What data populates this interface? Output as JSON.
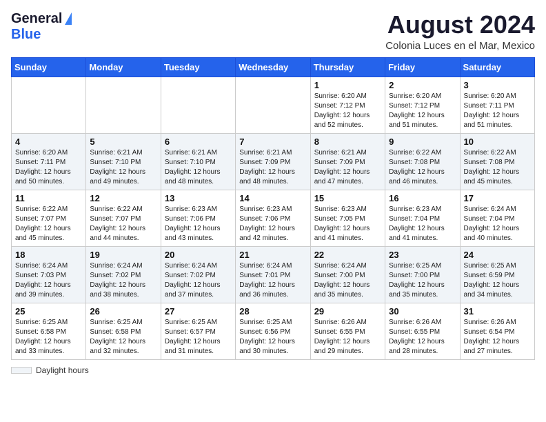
{
  "header": {
    "logo_general": "General",
    "logo_blue": "Blue",
    "month_title": "August 2024",
    "location": "Colonia Luces en el Mar, Mexico"
  },
  "days_of_week": [
    "Sunday",
    "Monday",
    "Tuesday",
    "Wednesday",
    "Thursday",
    "Friday",
    "Saturday"
  ],
  "weeks": [
    [
      {
        "day": "",
        "info": ""
      },
      {
        "day": "",
        "info": ""
      },
      {
        "day": "",
        "info": ""
      },
      {
        "day": "",
        "info": ""
      },
      {
        "day": "1",
        "info": "Sunrise: 6:20 AM\nSunset: 7:12 PM\nDaylight: 12 hours\nand 52 minutes."
      },
      {
        "day": "2",
        "info": "Sunrise: 6:20 AM\nSunset: 7:12 PM\nDaylight: 12 hours\nand 51 minutes."
      },
      {
        "day": "3",
        "info": "Sunrise: 6:20 AM\nSunset: 7:11 PM\nDaylight: 12 hours\nand 51 minutes."
      }
    ],
    [
      {
        "day": "4",
        "info": "Sunrise: 6:20 AM\nSunset: 7:11 PM\nDaylight: 12 hours\nand 50 minutes."
      },
      {
        "day": "5",
        "info": "Sunrise: 6:21 AM\nSunset: 7:10 PM\nDaylight: 12 hours\nand 49 minutes."
      },
      {
        "day": "6",
        "info": "Sunrise: 6:21 AM\nSunset: 7:10 PM\nDaylight: 12 hours\nand 48 minutes."
      },
      {
        "day": "7",
        "info": "Sunrise: 6:21 AM\nSunset: 7:09 PM\nDaylight: 12 hours\nand 48 minutes."
      },
      {
        "day": "8",
        "info": "Sunrise: 6:21 AM\nSunset: 7:09 PM\nDaylight: 12 hours\nand 47 minutes."
      },
      {
        "day": "9",
        "info": "Sunrise: 6:22 AM\nSunset: 7:08 PM\nDaylight: 12 hours\nand 46 minutes."
      },
      {
        "day": "10",
        "info": "Sunrise: 6:22 AM\nSunset: 7:08 PM\nDaylight: 12 hours\nand 45 minutes."
      }
    ],
    [
      {
        "day": "11",
        "info": "Sunrise: 6:22 AM\nSunset: 7:07 PM\nDaylight: 12 hours\nand 45 minutes."
      },
      {
        "day": "12",
        "info": "Sunrise: 6:22 AM\nSunset: 7:07 PM\nDaylight: 12 hours\nand 44 minutes."
      },
      {
        "day": "13",
        "info": "Sunrise: 6:23 AM\nSunset: 7:06 PM\nDaylight: 12 hours\nand 43 minutes."
      },
      {
        "day": "14",
        "info": "Sunrise: 6:23 AM\nSunset: 7:06 PM\nDaylight: 12 hours\nand 42 minutes."
      },
      {
        "day": "15",
        "info": "Sunrise: 6:23 AM\nSunset: 7:05 PM\nDaylight: 12 hours\nand 41 minutes."
      },
      {
        "day": "16",
        "info": "Sunrise: 6:23 AM\nSunset: 7:04 PM\nDaylight: 12 hours\nand 41 minutes."
      },
      {
        "day": "17",
        "info": "Sunrise: 6:24 AM\nSunset: 7:04 PM\nDaylight: 12 hours\nand 40 minutes."
      }
    ],
    [
      {
        "day": "18",
        "info": "Sunrise: 6:24 AM\nSunset: 7:03 PM\nDaylight: 12 hours\nand 39 minutes."
      },
      {
        "day": "19",
        "info": "Sunrise: 6:24 AM\nSunset: 7:02 PM\nDaylight: 12 hours\nand 38 minutes."
      },
      {
        "day": "20",
        "info": "Sunrise: 6:24 AM\nSunset: 7:02 PM\nDaylight: 12 hours\nand 37 minutes."
      },
      {
        "day": "21",
        "info": "Sunrise: 6:24 AM\nSunset: 7:01 PM\nDaylight: 12 hours\nand 36 minutes."
      },
      {
        "day": "22",
        "info": "Sunrise: 6:24 AM\nSunset: 7:00 PM\nDaylight: 12 hours\nand 35 minutes."
      },
      {
        "day": "23",
        "info": "Sunrise: 6:25 AM\nSunset: 7:00 PM\nDaylight: 12 hours\nand 35 minutes."
      },
      {
        "day": "24",
        "info": "Sunrise: 6:25 AM\nSunset: 6:59 PM\nDaylight: 12 hours\nand 34 minutes."
      }
    ],
    [
      {
        "day": "25",
        "info": "Sunrise: 6:25 AM\nSunset: 6:58 PM\nDaylight: 12 hours\nand 33 minutes."
      },
      {
        "day": "26",
        "info": "Sunrise: 6:25 AM\nSunset: 6:58 PM\nDaylight: 12 hours\nand 32 minutes."
      },
      {
        "day": "27",
        "info": "Sunrise: 6:25 AM\nSunset: 6:57 PM\nDaylight: 12 hours\nand 31 minutes."
      },
      {
        "day": "28",
        "info": "Sunrise: 6:25 AM\nSunset: 6:56 PM\nDaylight: 12 hours\nand 30 minutes."
      },
      {
        "day": "29",
        "info": "Sunrise: 6:26 AM\nSunset: 6:55 PM\nDaylight: 12 hours\nand 29 minutes."
      },
      {
        "day": "30",
        "info": "Sunrise: 6:26 AM\nSunset: 6:55 PM\nDaylight: 12 hours\nand 28 minutes."
      },
      {
        "day": "31",
        "info": "Sunrise: 6:26 AM\nSunset: 6:54 PM\nDaylight: 12 hours\nand 27 minutes."
      }
    ]
  ],
  "footer": {
    "label": "Daylight hours"
  }
}
